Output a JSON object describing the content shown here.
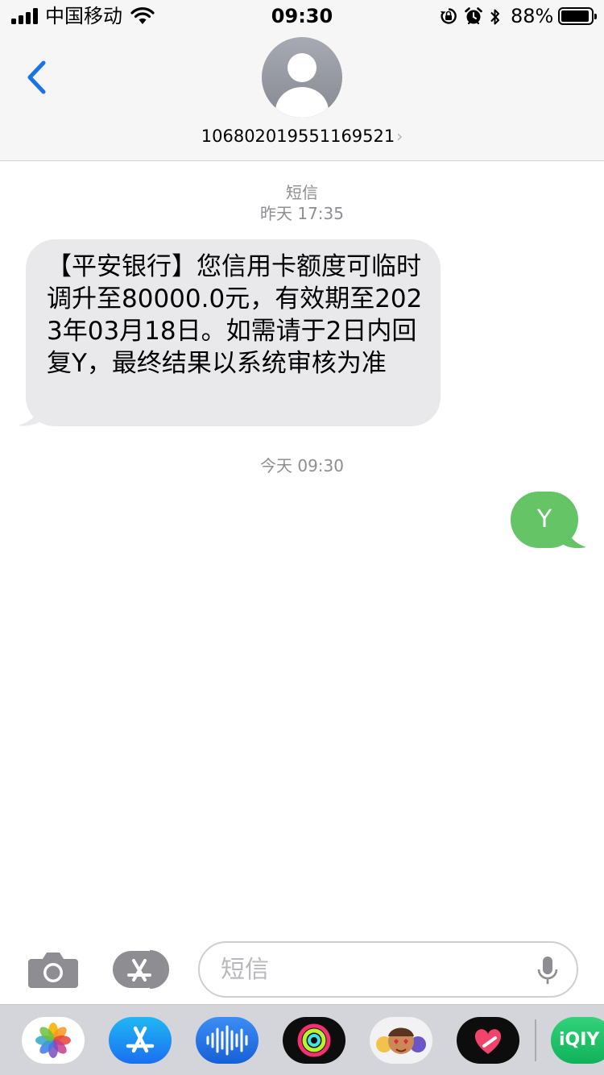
{
  "status_bar": {
    "carrier": "中国移动",
    "time": "09:30",
    "battery_percent": "88%"
  },
  "header": {
    "contact": "106802019551169521",
    "chevron": "›"
  },
  "conversation": {
    "service_label": "短信",
    "first_timestamp": "昨天 17:35",
    "incoming_message": "【平安银行】您信用卡额度可临时调升至80000.0元，有效期至2023年03月18日。如需请于2日内回复Y，最终结果以系统审核为准",
    "second_timestamp": "今天 09:30",
    "outgoing_message": "Y"
  },
  "input_bar": {
    "placeholder": "短信"
  },
  "app_drawer": {
    "apps": [
      {
        "icon": "photos-icon"
      },
      {
        "icon": "app-store-icon"
      },
      {
        "icon": "audio-messages-icon"
      },
      {
        "icon": "activity-icon"
      },
      {
        "icon": "memoji-icon"
      },
      {
        "icon": "digital-touch-icon"
      },
      {
        "icon": "iqiyi-icon",
        "label": "iQIY"
      }
    ]
  },
  "colors": {
    "accent_blue": "#1a73e8",
    "incoming_bubble": "#e9e9eb",
    "outgoing_bubble": "#65c466",
    "timestamp_gray": "#8e8e93"
  }
}
